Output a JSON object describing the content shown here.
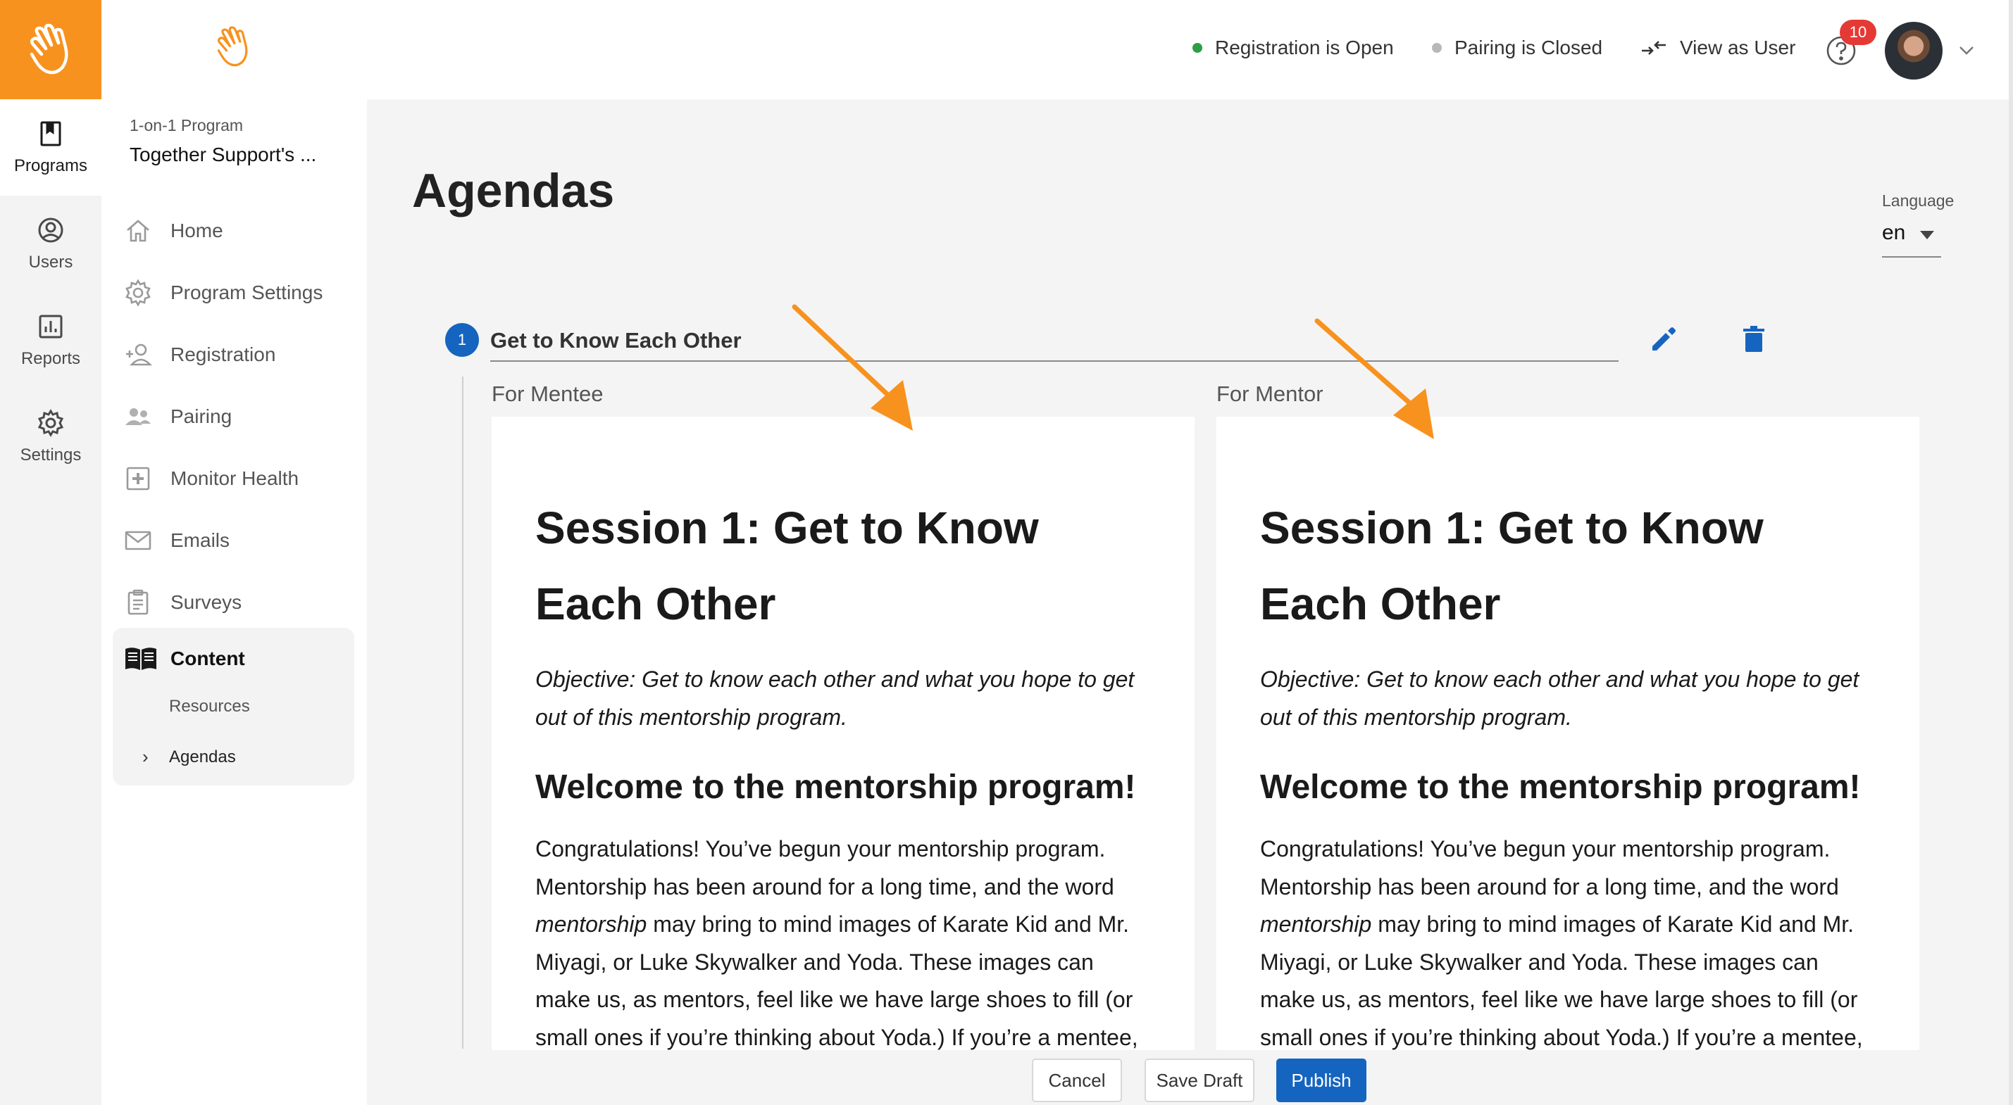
{
  "rail": {
    "items": [
      {
        "label": "Programs",
        "icon": "bookmark-book-icon",
        "active": true
      },
      {
        "label": "Users",
        "icon": "user-circle-icon"
      },
      {
        "label": "Reports",
        "icon": "bar-chart-icon"
      },
      {
        "label": "Settings",
        "icon": "gear-icon"
      }
    ]
  },
  "sidebar": {
    "program_kind": "1-on-1 Program",
    "program_name": "Together Support's ...",
    "items": [
      {
        "label": "Home",
        "icon": "home-icon"
      },
      {
        "label": "Program Settings",
        "icon": "gear-icon"
      },
      {
        "label": "Registration",
        "icon": "add-user-icon"
      },
      {
        "label": "Pairing",
        "icon": "pair-users-icon"
      },
      {
        "label": "Monitor Health",
        "icon": "plus-square-icon"
      },
      {
        "label": "Emails",
        "icon": "envelope-icon"
      },
      {
        "label": "Surveys",
        "icon": "clipboard-icon"
      }
    ],
    "content": {
      "label": "Content",
      "icon": "open-book-icon",
      "subitems": [
        {
          "label": "Resources"
        },
        {
          "label": "Agendas",
          "active": true
        }
      ]
    }
  },
  "topbar": {
    "registration_status": "Registration is Open",
    "pairing_status": "Pairing is Closed",
    "view_as_user": "View as User",
    "notification_count": "10",
    "colors": {
      "open": "#2e9e44",
      "closed": "#b8b8b8",
      "badge": "#e53935",
      "brand": "#f7921e"
    }
  },
  "main": {
    "title": "Agendas",
    "language": {
      "label": "Language",
      "value": "en"
    },
    "agenda": {
      "step": "1",
      "title": "Get to Know Each Other",
      "mentee_label": "For Mentee",
      "mentor_label": "For Mentor",
      "mentee_doc": {
        "heading": "Session 1: Get to Know Each Other",
        "objective": "Objective: Get to know each other and what you hope to get out of this mentorship program.",
        "subheading": "Welcome to the mentorship program!",
        "body_before": "Congratulations! You’ve begun your mentorship program. Mentorship has been around for a long time, and the word ",
        "body_em": "mentorship",
        "body_after": " may bring to mind images of Karate Kid and Mr. Miyagi, or Luke Skywalker and Yoda. These images can make us, as mentors, feel like we have large shoes to fill (or small ones if you’re thinking about Yoda.) If you’re a mentee,"
      },
      "mentor_doc": {
        "heading": "Session 1: Get to Know Each Other",
        "objective": "Objective: Get to know each other and what you hope to get out of this mentorship program.",
        "subheading": "Welcome to the mentorship program!",
        "body_before": "Congratulations! You’ve begun your mentorship program. Mentorship has been around for a long time, and the word ",
        "body_em": "mentorship",
        "body_after": " may bring to mind images of Karate Kid and Mr. Miyagi, or Luke Skywalker and Yoda. These images can make us, as mentors, feel like we have large shoes to fill (or small ones if you’re thinking about Yoda.) If you’re a mentee,"
      }
    }
  },
  "footer": {
    "cancel": "Cancel",
    "save_draft": "Save Draft",
    "publish": "Publish"
  },
  "colors": {
    "primary": "#1565c0",
    "arrow": "#f7921e"
  }
}
